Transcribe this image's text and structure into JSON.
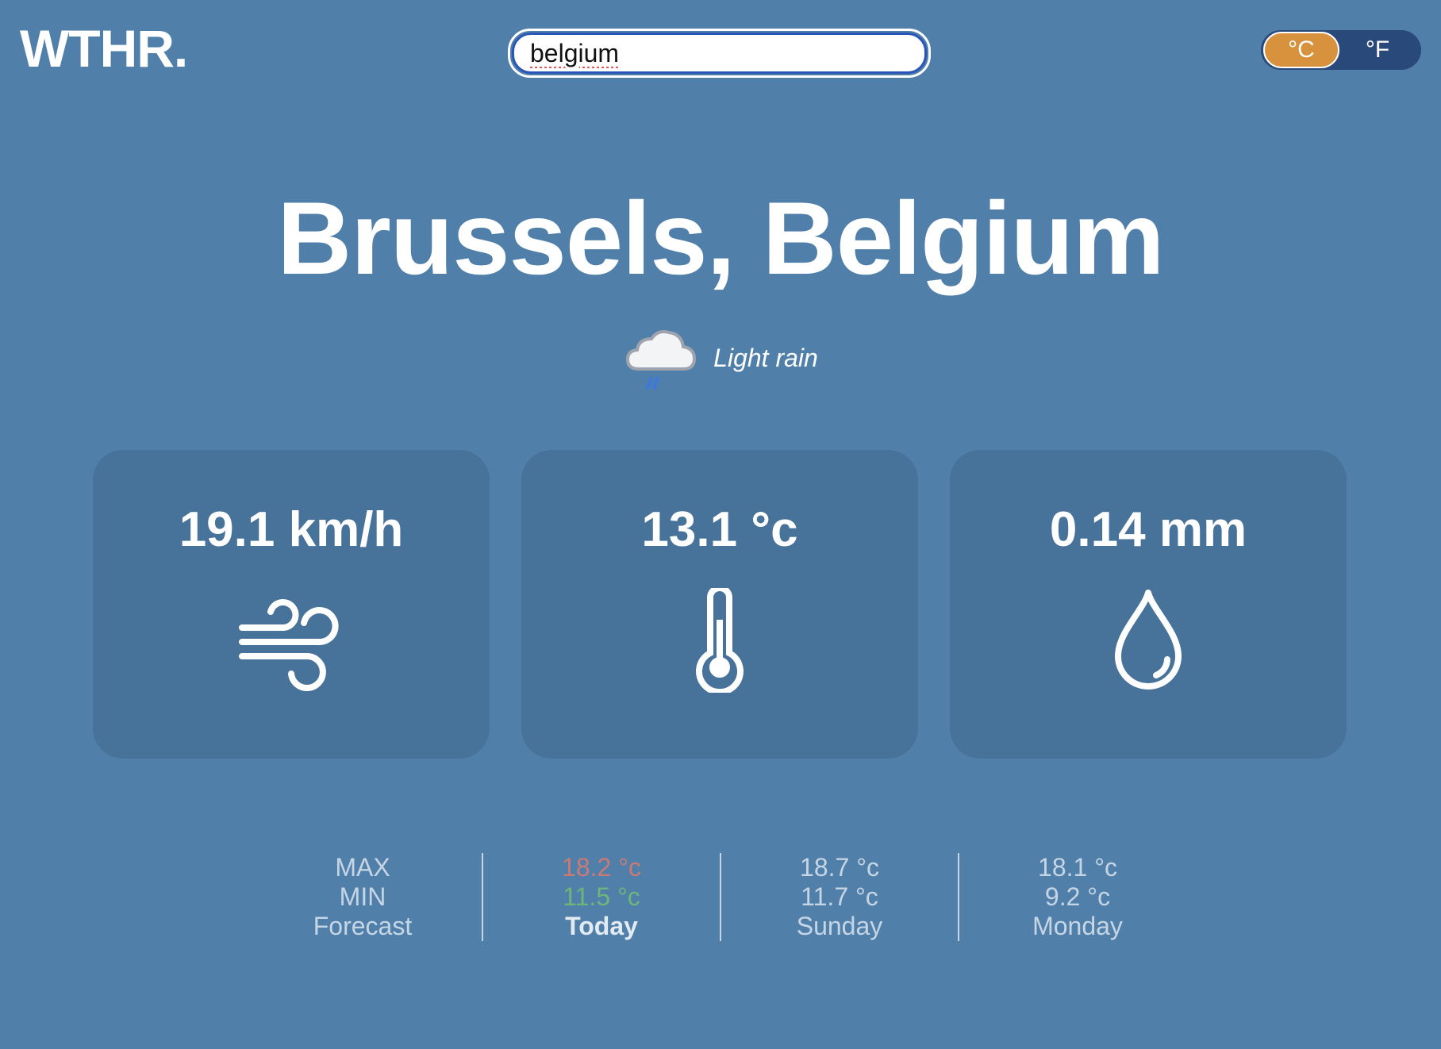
{
  "logo": "WTHR.",
  "search": {
    "value": "belgium"
  },
  "units": {
    "celsius": "°C",
    "fahrenheit": "°F",
    "selected": "celsius"
  },
  "location": "Brussels, Belgium",
  "condition": {
    "icon": "rain-cloud-icon",
    "text": "Light rain"
  },
  "cards": {
    "wind": {
      "value": "19.1 km/h",
      "icon": "wind-icon"
    },
    "temperature": {
      "value": "13.1 °c",
      "icon": "thermometer-icon"
    },
    "precipitation": {
      "value": "0.14 mm",
      "icon": "droplet-icon"
    }
  },
  "forecast": {
    "header": {
      "max": "MAX",
      "min": "MIN",
      "label": "Forecast"
    },
    "days": [
      {
        "max": "18.2 °c",
        "min": "11.5 °c",
        "day": "Today"
      },
      {
        "max": "18.7 °c",
        "min": "11.7 °c",
        "day": "Sunday"
      },
      {
        "max": "18.1 °c",
        "min": "9.2 °c",
        "day": "Monday"
      }
    ]
  },
  "colors": {
    "background": "#5080AA",
    "card": "#47729A",
    "toggle_active": "#D8913C",
    "toggle_track": "#28497A",
    "max_today": "#C97A74",
    "min_today": "#6EB57A"
  }
}
